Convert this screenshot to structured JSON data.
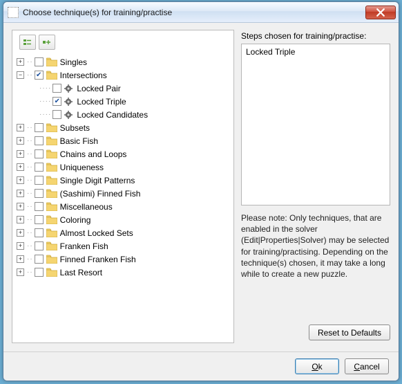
{
  "window": {
    "title": "Choose technique(s) for training/practise"
  },
  "toolbar": {
    "expand_all": "Expand all",
    "collapse_all": "Collapse all"
  },
  "tree": {
    "items": [
      {
        "label": "Singles",
        "expandable": true,
        "expanded": false,
        "checked": false,
        "type": "folder"
      },
      {
        "label": "Intersections",
        "expandable": true,
        "expanded": true,
        "checked": true,
        "type": "folder",
        "children": [
          {
            "label": "Locked Pair",
            "checked": false
          },
          {
            "label": "Locked Triple",
            "checked": true
          },
          {
            "label": "Locked Candidates",
            "checked": false
          }
        ]
      },
      {
        "label": "Subsets",
        "expandable": true,
        "expanded": false,
        "checked": false,
        "type": "folder"
      },
      {
        "label": "Basic Fish",
        "expandable": true,
        "expanded": false,
        "checked": false,
        "type": "folder"
      },
      {
        "label": "Chains and Loops",
        "expandable": true,
        "expanded": false,
        "checked": false,
        "type": "folder"
      },
      {
        "label": "Uniqueness",
        "expandable": true,
        "expanded": false,
        "checked": false,
        "type": "folder"
      },
      {
        "label": "Single Digit Patterns",
        "expandable": true,
        "expanded": false,
        "checked": false,
        "type": "folder"
      },
      {
        "label": "(Sashimi) Finned Fish",
        "expandable": true,
        "expanded": false,
        "checked": false,
        "type": "folder"
      },
      {
        "label": "Miscellaneous",
        "expandable": true,
        "expanded": false,
        "checked": false,
        "type": "folder"
      },
      {
        "label": "Coloring",
        "expandable": true,
        "expanded": false,
        "checked": false,
        "type": "folder"
      },
      {
        "label": "Almost Locked Sets",
        "expandable": true,
        "expanded": false,
        "checked": false,
        "type": "folder"
      },
      {
        "label": "Franken Fish",
        "expandable": true,
        "expanded": false,
        "checked": false,
        "type": "folder"
      },
      {
        "label": "Finned Franken Fish",
        "expandable": true,
        "expanded": false,
        "checked": false,
        "type": "folder"
      },
      {
        "label": "Last Resort",
        "expandable": true,
        "expanded": false,
        "checked": false,
        "type": "folder"
      }
    ]
  },
  "right": {
    "steps_label": "Steps chosen for training/practise:",
    "chosen_steps": [
      "Locked Triple"
    ],
    "note": "Please note: Only techniques, that are enabled in the solver (Edit|Properties|Solver) may be selected for training/practising. Depending on the technique(s) chosen, it may take a long while to create a new puzzle.",
    "reset_label": "Reset to Defaults"
  },
  "footer": {
    "ok": "Ok",
    "cancel": "Cancel"
  }
}
